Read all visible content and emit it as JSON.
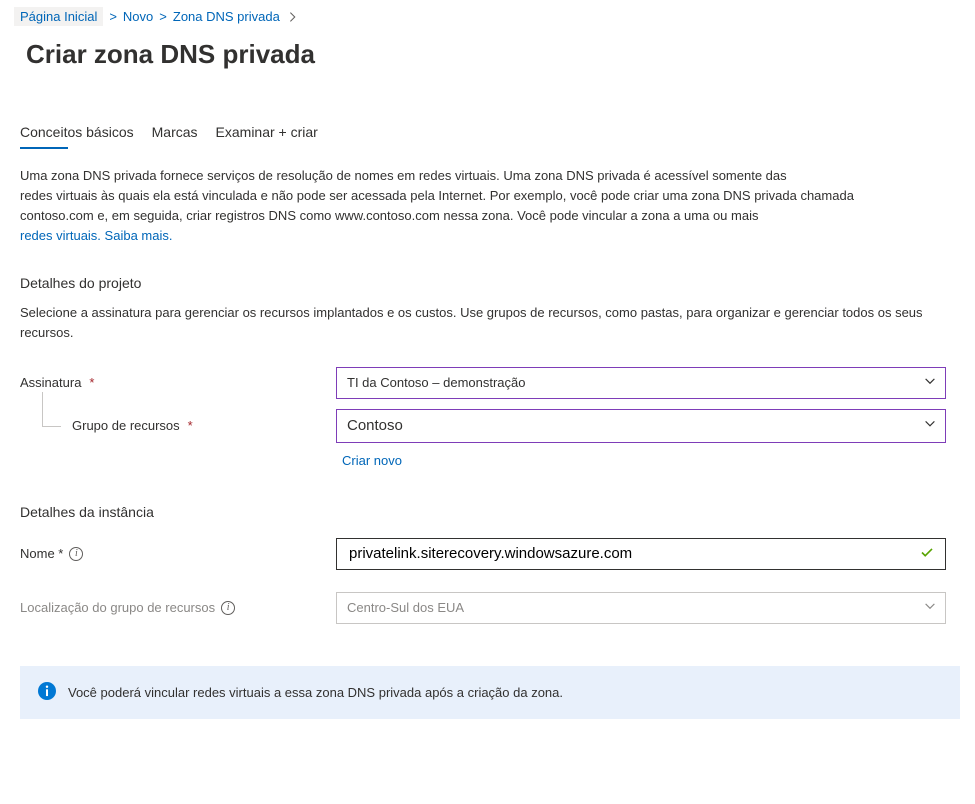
{
  "breadcrumb": {
    "items": [
      {
        "label": "Página Inicial"
      },
      {
        "label": "Novo"
      },
      {
        "label": "Zona DNS privada"
      }
    ]
  },
  "page_title": "Criar zona DNS privada",
  "tabs": {
    "basics": "Conceitos básicos",
    "tags": "Marcas",
    "review": "Examinar + criar"
  },
  "intro": {
    "body1": "Uma zona DNS privada fornece serviços de resolução de nomes em redes virtuais. Uma zona DNS privada é acessível somente das",
    "body2": "redes virtuais às quais ela está vinculada e não pode ser acessada pela Internet. Por exemplo, você pode criar uma zona DNS privada chamada",
    "body3": "contoso.com e, em seguida, criar registros DNS como www.contoso.com nessa zona. Você pode vincular a zona a uma ou mais",
    "link_vnets": "redes virtuais.",
    "link_learn": "Saiba mais."
  },
  "project": {
    "heading": "Detalhes do projeto",
    "sub": "Selecione a assinatura para gerenciar os recursos implantados e os custos. Use grupos de recursos, como pastas, para organizar e gerenciar todos os seus recursos.",
    "subscription_label": "Assinatura",
    "subscription_value": "TI da Contoso – demonstração",
    "rg_label": "Grupo de recursos",
    "rg_value": "Contoso",
    "create_new": "Criar novo"
  },
  "instance": {
    "heading": "Detalhes da instância",
    "name_label": "Nome *",
    "name_value": "privatelink.siterecovery.windowsazure.com",
    "location_label": "Localização do grupo de recursos",
    "location_value": "Centro-Sul dos EUA"
  },
  "banner": {
    "text": "Você poderá vincular redes virtuais a essa zona DNS privada após a criação da zona."
  }
}
